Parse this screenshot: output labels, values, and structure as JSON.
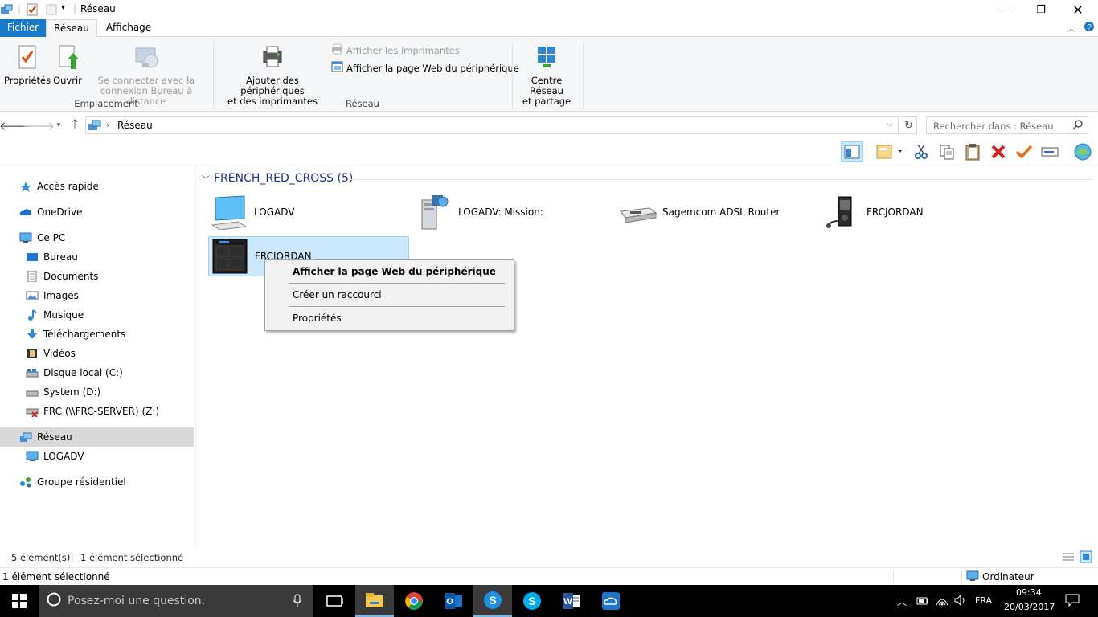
{
  "window": {
    "title": "Réseau"
  },
  "ribbon_tabs": {
    "file": "Fichier",
    "network": "Réseau",
    "view": "Affichage"
  },
  "ribbon": {
    "properties": "Propriétés",
    "open": "Ouvrir",
    "remote_line1": "Se connecter avec la",
    "remote_line2": "connexion Bureau à distance",
    "group_location": "Emplacement",
    "add_devices_line1": "Ajouter des périphériques",
    "add_devices_line2": "et des imprimantes",
    "show_printers": "Afficher les imprimantes",
    "show_webpage": "Afficher la page Web du périphérique",
    "group_network": "Réseau",
    "center_line1": "Centre Réseau",
    "center_line2": "et partage"
  },
  "address": {
    "location": "Réseau",
    "search_placeholder": "Rechercher dans : Réseau"
  },
  "nav": {
    "quick_access": "Accès rapide",
    "onedrive": "OneDrive",
    "this_pc": "Ce PC",
    "desktop": "Bureau",
    "documents": "Documents",
    "images": "Images",
    "music": "Musique",
    "downloads": "Téléchargements",
    "videos": "Vidéos",
    "local_disk": "Disque local (C:)",
    "system": "System (D:)",
    "frc": "FRC (\\\\FRC-SERVER) (Z:)",
    "network": "Réseau",
    "logadv": "LOGADV",
    "homegroup": "Groupe résidentiel"
  },
  "content": {
    "group_title": "FRENCH_RED_CROSS (5)",
    "items": [
      {
        "label": "LOGADV",
        "icon": "computer-icon"
      },
      {
        "label": "LOGADV: Mission:",
        "icon": "media-server-icon"
      },
      {
        "label": "Sagemcom ADSL Router",
        "icon": "router-icon"
      },
      {
        "label": "FRCJORDAN",
        "icon": "media-player-icon"
      },
      {
        "label": "FRCJORDAN",
        "icon": "nas-icon"
      }
    ]
  },
  "context_menu": {
    "item1": "Afficher la page Web du périphérique",
    "item2": "Créer un raccourci",
    "item3": "Propriétés"
  },
  "status": {
    "count": "5 élément(s)",
    "selected": "1 élément sélectionné"
  },
  "details": {
    "left": "1 élément sélectionné",
    "right": "Ordinateur"
  },
  "taskbar": {
    "search_placeholder": "Posez-moi une question.",
    "language": "FRA",
    "time": "09:34",
    "date": "20/03/2017"
  },
  "colors": {
    "accent": "#1979ca",
    "selection": "#cce8ff",
    "group_header": "#1e3287"
  }
}
